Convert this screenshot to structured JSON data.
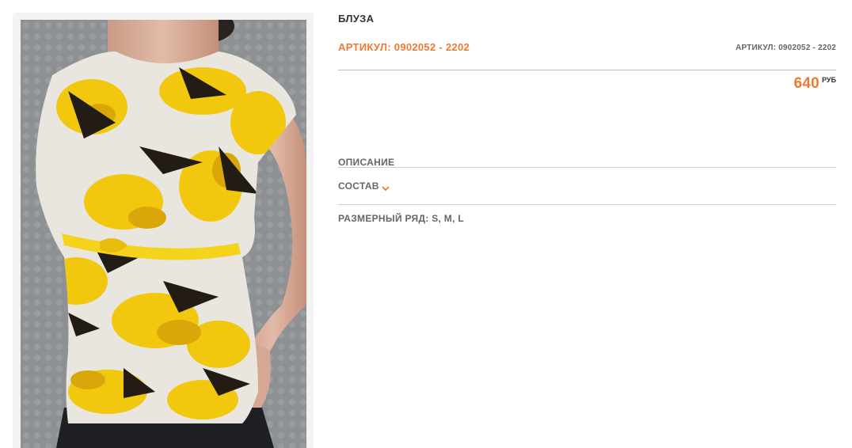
{
  "product": {
    "title": "БЛУЗА",
    "sku_main": "АРТИКУЛ: 0902052 - 2202",
    "sku_small": "АРТИКУЛ: 0902052 - 2202",
    "price_value": "640",
    "price_currency": "РУБ",
    "description_label": "ОПИСАНИЕ",
    "composition_label": "СОСТАВ",
    "sizes_label": "РАЗМЕРНЫЙ РЯД: S, M, L"
  },
  "icons": {
    "composition_toggle": "chevron-down-icon"
  },
  "colors": {
    "accent": "#ee7a30",
    "text": "#333333",
    "muted": "#666666",
    "divider": "#cfcfcf"
  }
}
